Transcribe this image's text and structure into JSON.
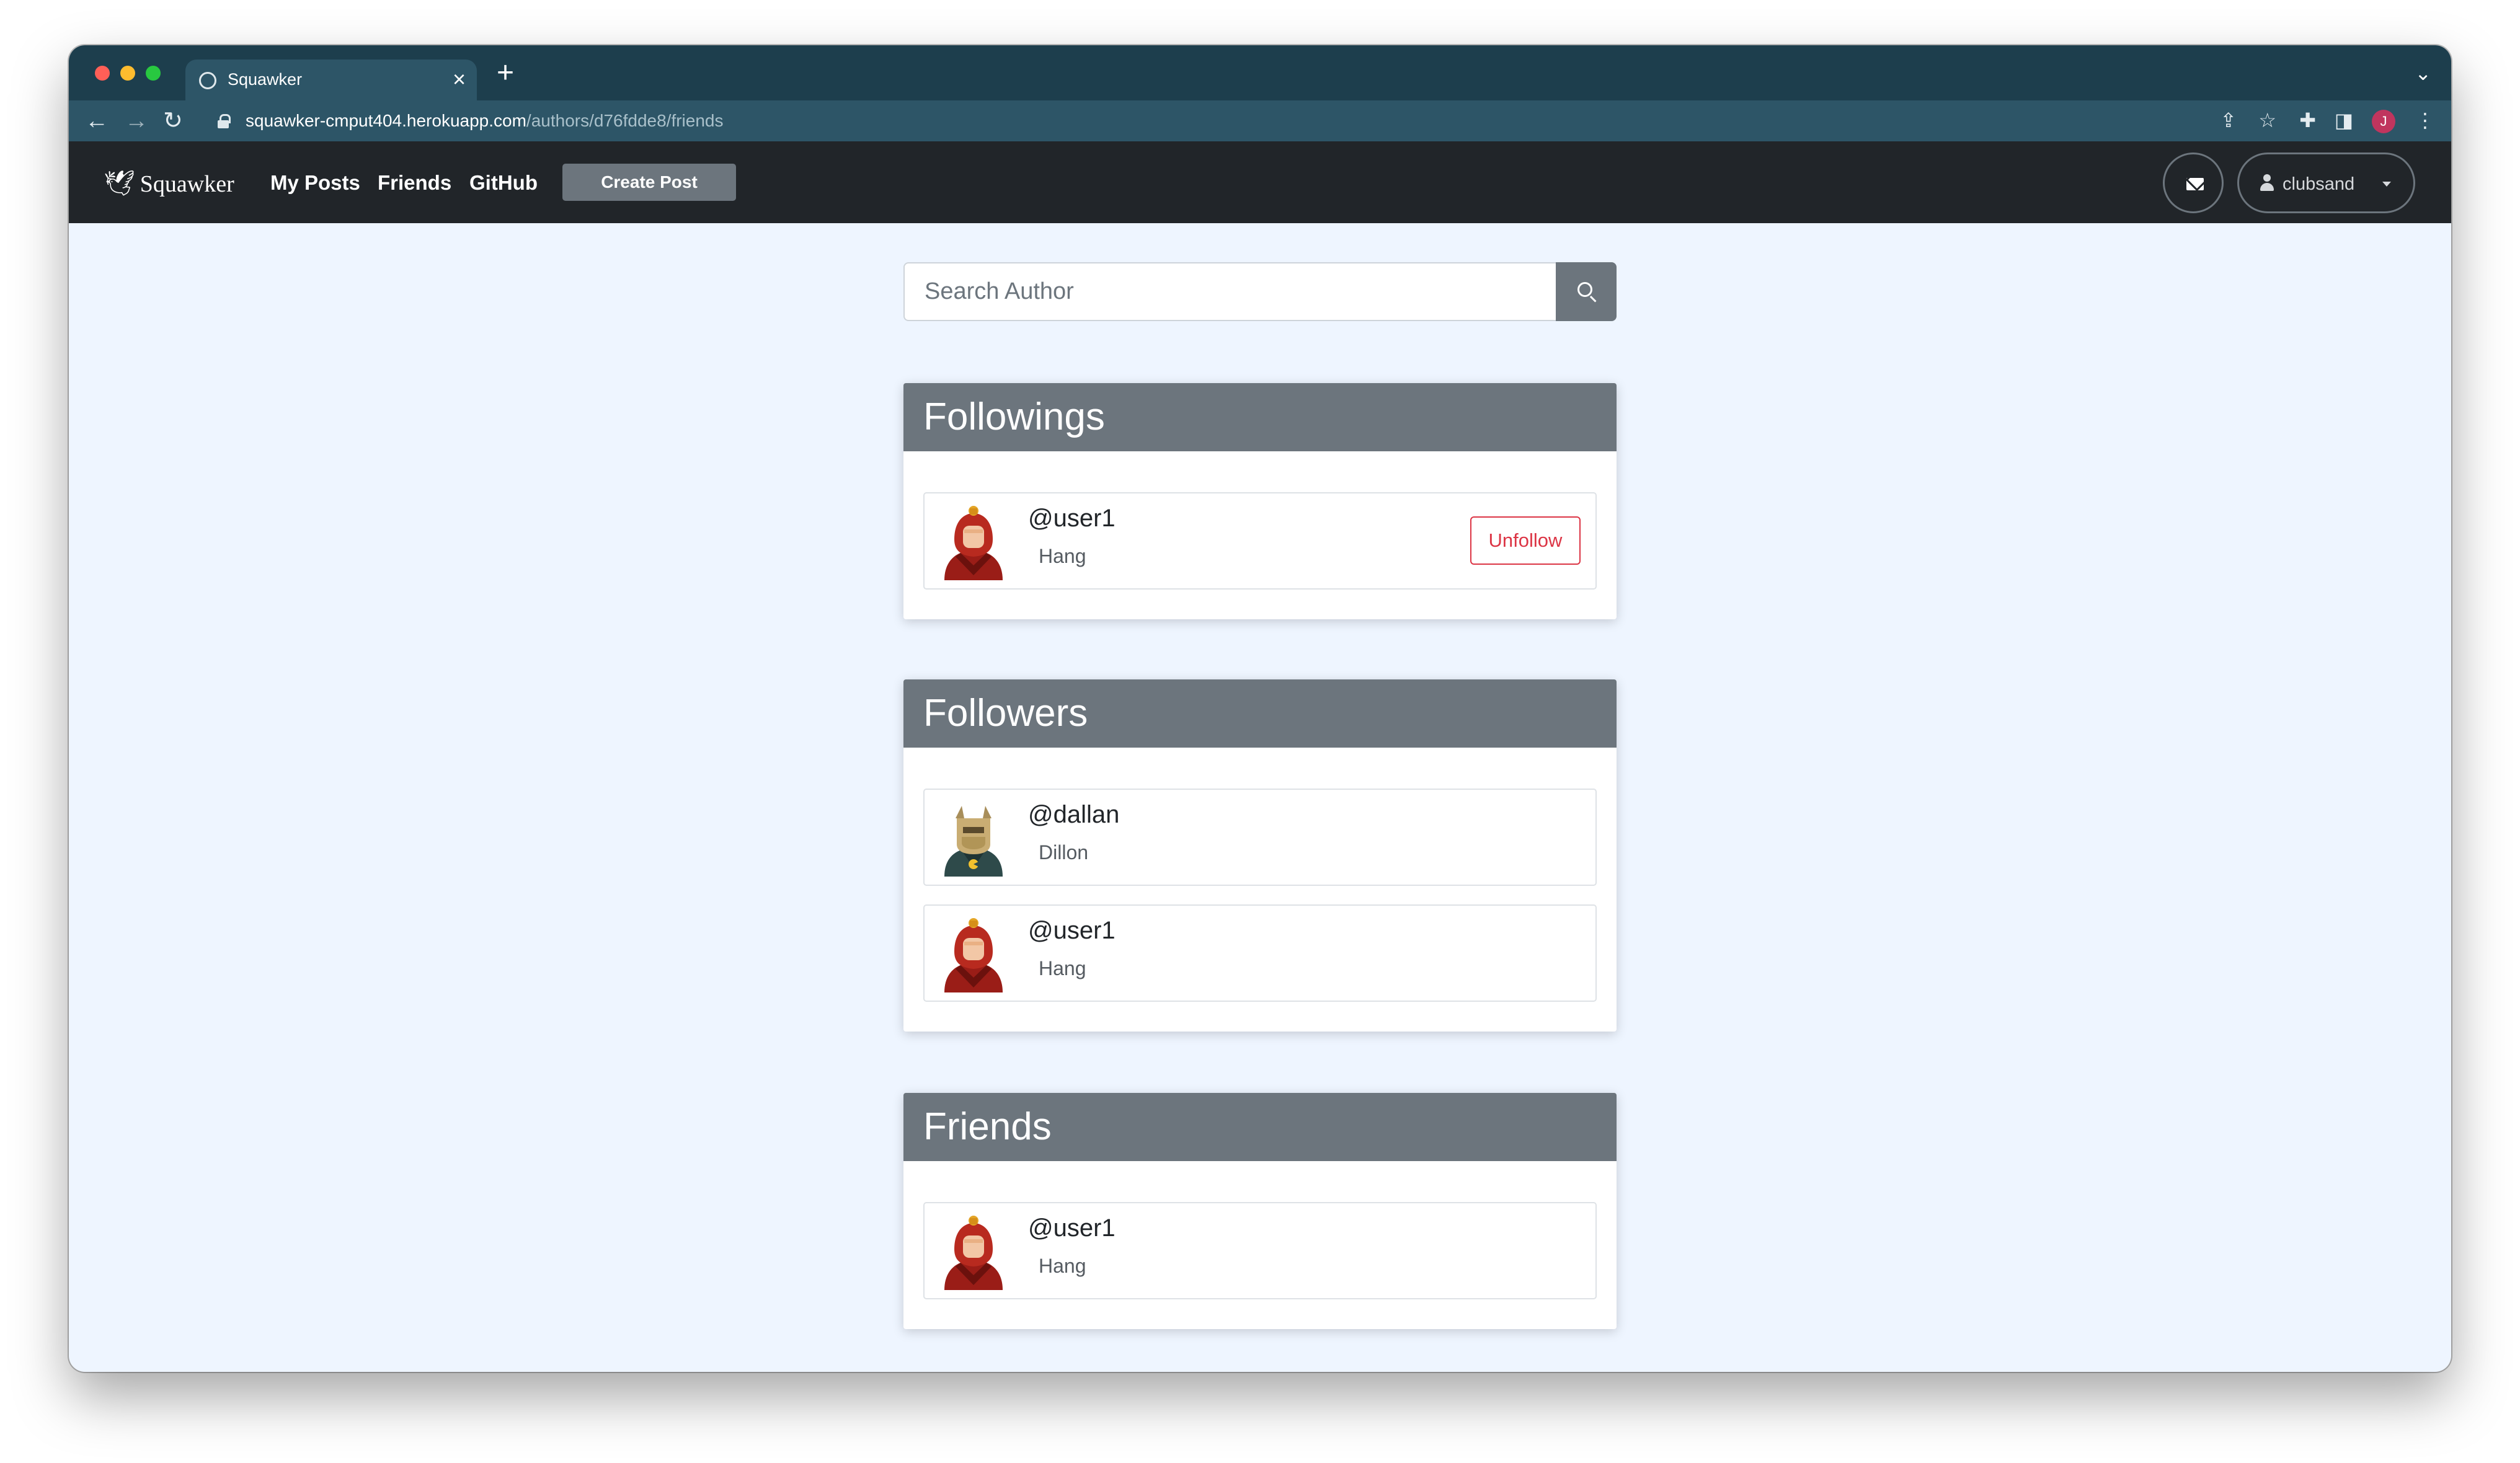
{
  "browser": {
    "tab_title": "Squawker",
    "tab_close": "×",
    "new_tab": "+",
    "tab_menu": "⌄",
    "url_host": "squawker-cmput404.herokuapp.com",
    "url_path": "/authors/d76fdde8/friends",
    "profile_initial": "J"
  },
  "navbar": {
    "brand": "Squawker",
    "links": [
      "My Posts",
      "Friends",
      "GitHub"
    ],
    "create_post": "Create Post",
    "username": "clubsand"
  },
  "search": {
    "placeholder": "Search Author"
  },
  "sections": {
    "followings": {
      "title": "Followings",
      "items": [
        {
          "handle": "@user1",
          "name": "Hang",
          "action": "Unfollow",
          "avatar": "red-hooded-avatar-icon"
        }
      ]
    },
    "followers": {
      "title": "Followers",
      "items": [
        {
          "handle": "@dallan",
          "name": "Dillon",
          "avatar": "horned-helmet-avatar-icon"
        },
        {
          "handle": "@user1",
          "name": "Hang",
          "avatar": "red-hooded-avatar-icon"
        }
      ]
    },
    "friends": {
      "title": "Friends",
      "items": [
        {
          "handle": "@user1",
          "name": "Hang",
          "avatar": "red-hooded-avatar-icon"
        }
      ]
    }
  },
  "colors": {
    "navbar_bg": "#212529",
    "card_header_bg": "#6c757d",
    "page_bg": "#eef5ff",
    "danger": "#dc3545",
    "chrome_frame": "#1d3e4d"
  }
}
